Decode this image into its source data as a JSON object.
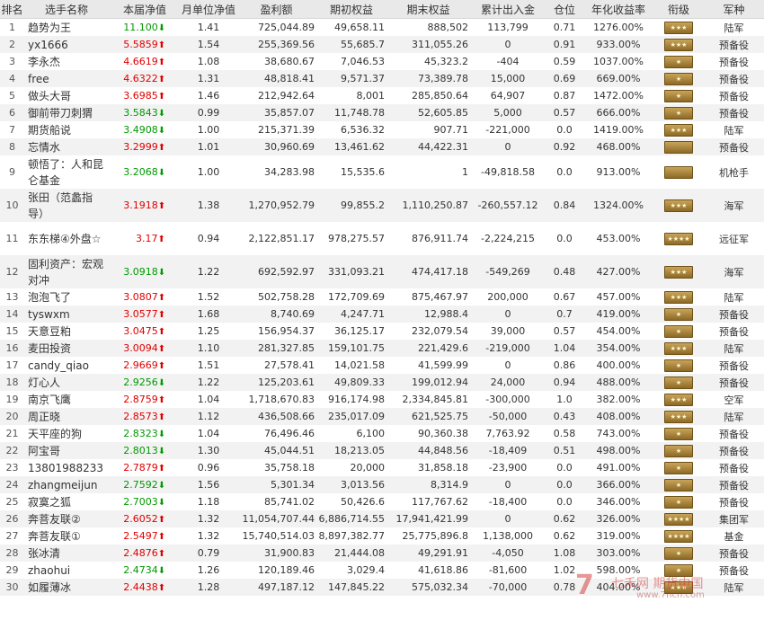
{
  "headers": [
    "排名",
    "选手名称",
    "本届净值",
    "月单位净值",
    "盈利额",
    "期初权益",
    "期末权益",
    "累计出入金",
    "仓位",
    "年化收益率",
    "衔级",
    "军种"
  ],
  "colors": {
    "up": "#e00000",
    "down": "#009900",
    "alt_row": "#f2f2f2",
    "header_bg": "#e9e9e9"
  },
  "rows": [
    {
      "rank": "1",
      "name": "趋势为王",
      "nav": "11.100",
      "dir": "down",
      "mnav": "1.41",
      "profit": "725,044.89",
      "start": "49,658.11",
      "end": "888,502",
      "flow": "113,799",
      "pos": "0.71",
      "annual": "1276.00%",
      "badge": "★★★",
      "branch": "陆军"
    },
    {
      "rank": "2",
      "name": "yx1666",
      "nav": "5.5859",
      "dir": "up",
      "mnav": "1.54",
      "profit": "255,369.56",
      "start": "55,685.7",
      "end": "311,055.26",
      "flow": "0",
      "pos": "0.91",
      "annual": "933.00%",
      "badge": "★★★",
      "branch": "预备役"
    },
    {
      "rank": "3",
      "name": "李永杰",
      "nav": "4.6619",
      "dir": "up",
      "mnav": "1.08",
      "profit": "38,680.67",
      "start": "7,046.53",
      "end": "45,323.2",
      "flow": "-404",
      "pos": "0.59",
      "annual": "1037.00%",
      "badge": "★",
      "branch": "预备役"
    },
    {
      "rank": "4",
      "name": "free",
      "nav": "4.6322",
      "dir": "up",
      "mnav": "1.31",
      "profit": "48,818.41",
      "start": "9,571.37",
      "end": "73,389.78",
      "flow": "15,000",
      "pos": "0.69",
      "annual": "669.00%",
      "badge": "★",
      "branch": "预备役"
    },
    {
      "rank": "5",
      "name": "做头大哥",
      "nav": "3.6985",
      "dir": "up",
      "mnav": "1.46",
      "profit": "212,942.64",
      "start": "8,001",
      "end": "285,850.64",
      "flow": "64,907",
      "pos": "0.87",
      "annual": "1472.00%",
      "badge": "★",
      "branch": "预备役"
    },
    {
      "rank": "6",
      "name": "御前带刀刺猬",
      "nav": "3.5843",
      "dir": "down",
      "mnav": "0.99",
      "profit": "35,857.07",
      "start": "11,748.78",
      "end": "52,605.85",
      "flow": "5,000",
      "pos": "0.57",
      "annual": "666.00%",
      "badge": "★",
      "branch": "预备役"
    },
    {
      "rank": "7",
      "name": "期货船说",
      "nav": "3.4908",
      "dir": "down",
      "mnav": "1.00",
      "profit": "215,371.39",
      "start": "6,536.32",
      "end": "907.71",
      "flow": "-221,000",
      "pos": "0.0",
      "annual": "1419.00%",
      "badge": "★★★",
      "branch": "陆军"
    },
    {
      "rank": "8",
      "name": "忘情水",
      "nav": "3.2999",
      "dir": "up",
      "mnav": "1.01",
      "profit": "30,960.69",
      "start": "13,461.62",
      "end": "44,422.31",
      "flow": "0",
      "pos": "0.92",
      "annual": "468.00%",
      "badge": "",
      "branch": "预备役"
    },
    {
      "rank": "9",
      "name": "顿悟了：人和昆仑基金",
      "nav": "3.2068",
      "dir": "down",
      "mnav": "1.00",
      "profit": "34,283.98",
      "start": "15,535.6",
      "end": "1",
      "flow": "-49,818.58",
      "pos": "0.0",
      "annual": "913.00%",
      "badge": "",
      "branch": "机枪手"
    },
    {
      "rank": "10",
      "name": "张田（范蠡指导）",
      "nav": "3.1918",
      "dir": "up",
      "mnav": "1.38",
      "profit": "1,270,952.79",
      "start": "99,855.2",
      "end": "1,110,250.87",
      "flow": "-260,557.12",
      "pos": "0.84",
      "annual": "1324.00%",
      "badge": "★★★",
      "branch": "海军"
    },
    {
      "rank": "11",
      "name": "东东梯④外盘☆",
      "nav": "3.17",
      "dir": "up",
      "mnav": "0.94",
      "profit": "2,122,851.17",
      "start": "978,275.57",
      "end": "876,911.74",
      "flow": "-2,224,215",
      "pos": "0.0",
      "annual": "453.00%",
      "badge": "★★★★",
      "branch": "远征军"
    },
    {
      "rank": "12",
      "name": "固利资产：宏观对冲",
      "nav": "3.0918",
      "dir": "down",
      "mnav": "1.22",
      "profit": "692,592.97",
      "start": "331,093.21",
      "end": "474,417.18",
      "flow": "-549,269",
      "pos": "0.48",
      "annual": "427.00%",
      "badge": "★★★",
      "branch": "海军"
    },
    {
      "rank": "13",
      "name": "泡泡飞了",
      "nav": "3.0807",
      "dir": "up",
      "mnav": "1.52",
      "profit": "502,758.28",
      "start": "172,709.69",
      "end": "875,467.97",
      "flow": "200,000",
      "pos": "0.67",
      "annual": "457.00%",
      "badge": "★★★",
      "branch": "陆军"
    },
    {
      "rank": "14",
      "name": "tyswxm",
      "nav": "3.0577",
      "dir": "up",
      "mnav": "1.68",
      "profit": "8,740.69",
      "start": "4,247.71",
      "end": "12,988.4",
      "flow": "0",
      "pos": "0.7",
      "annual": "419.00%",
      "badge": "★",
      "branch": "预备役"
    },
    {
      "rank": "15",
      "name": "天意豆粕",
      "nav": "3.0475",
      "dir": "up",
      "mnav": "1.25",
      "profit": "156,954.37",
      "start": "36,125.17",
      "end": "232,079.54",
      "flow": "39,000",
      "pos": "0.57",
      "annual": "454.00%",
      "badge": "★",
      "branch": "预备役"
    },
    {
      "rank": "16",
      "name": "麦田投资",
      "nav": "3.0094",
      "dir": "up",
      "mnav": "1.10",
      "profit": "281,327.85",
      "start": "159,101.75",
      "end": "221,429.6",
      "flow": "-219,000",
      "pos": "1.04",
      "annual": "354.00%",
      "badge": "★★★",
      "branch": "陆军"
    },
    {
      "rank": "17",
      "name": "candy_qiao",
      "nav": "2.9669",
      "dir": "up",
      "mnav": "1.51",
      "profit": "27,578.41",
      "start": "14,021.58",
      "end": "41,599.99",
      "flow": "0",
      "pos": "0.86",
      "annual": "400.00%",
      "badge": "★",
      "branch": "预备役"
    },
    {
      "rank": "18",
      "name": "灯心人",
      "nav": "2.9256",
      "dir": "down",
      "mnav": "1.22",
      "profit": "125,203.61",
      "start": "49,809.33",
      "end": "199,012.94",
      "flow": "24,000",
      "pos": "0.94",
      "annual": "488.00%",
      "badge": "★",
      "branch": "预备役"
    },
    {
      "rank": "19",
      "name": "南京飞鹰",
      "nav": "2.8759",
      "dir": "up",
      "mnav": "1.04",
      "profit": "1,718,670.83",
      "start": "916,174.98",
      "end": "2,334,845.81",
      "flow": "-300,000",
      "pos": "1.0",
      "annual": "382.00%",
      "badge": "★★★",
      "branch": "空军"
    },
    {
      "rank": "20",
      "name": "周正晓",
      "nav": "2.8573",
      "dir": "up",
      "mnav": "1.12",
      "profit": "436,508.66",
      "start": "235,017.09",
      "end": "621,525.75",
      "flow": "-50,000",
      "pos": "0.43",
      "annual": "408.00%",
      "badge": "★★★",
      "branch": "陆军"
    },
    {
      "rank": "21",
      "name": "天平座的狗",
      "nav": "2.8323",
      "dir": "down",
      "mnav": "1.04",
      "profit": "76,496.46",
      "start": "6,100",
      "end": "90,360.38",
      "flow": "7,763.92",
      "pos": "0.58",
      "annual": "743.00%",
      "badge": "★",
      "branch": "预备役"
    },
    {
      "rank": "22",
      "name": "阿宝哥",
      "nav": "2.8013",
      "dir": "down",
      "mnav": "1.30",
      "profit": "45,044.51",
      "start": "18,213.05",
      "end": "44,848.56",
      "flow": "-18,409",
      "pos": "0.51",
      "annual": "498.00%",
      "badge": "★",
      "branch": "预备役"
    },
    {
      "rank": "23",
      "name": "13801988233",
      "nav": "2.7879",
      "dir": "up",
      "mnav": "0.96",
      "profit": "35,758.18",
      "start": "20,000",
      "end": "31,858.18",
      "flow": "-23,900",
      "pos": "0.0",
      "annual": "491.00%",
      "badge": "★",
      "branch": "预备役"
    },
    {
      "rank": "24",
      "name": "zhangmeijun",
      "nav": "2.7592",
      "dir": "down",
      "mnav": "1.56",
      "profit": "5,301.34",
      "start": "3,013.56",
      "end": "8,314.9",
      "flow": "0",
      "pos": "0.0",
      "annual": "366.00%",
      "badge": "★",
      "branch": "预备役"
    },
    {
      "rank": "25",
      "name": "寂寞之狐",
      "nav": "2.7003",
      "dir": "down",
      "mnav": "1.18",
      "profit": "85,741.02",
      "start": "50,426.6",
      "end": "117,767.62",
      "flow": "-18,400",
      "pos": "0.0",
      "annual": "346.00%",
      "badge": "★",
      "branch": "预备役"
    },
    {
      "rank": "26",
      "name": "奔菩友联②",
      "nav": "2.6052",
      "dir": "up",
      "mnav": "1.32",
      "profit": "11,054,707.44",
      "start": "6,886,714.55",
      "end": "17,941,421.99",
      "flow": "0",
      "pos": "0.62",
      "annual": "326.00%",
      "badge": "★★★★",
      "branch": "集团军"
    },
    {
      "rank": "27",
      "name": "奔菩友联①",
      "nav": "2.5497",
      "dir": "up",
      "mnav": "1.32",
      "profit": "15,740,514.03",
      "start": "8,897,382.77",
      "end": "25,775,896.8",
      "flow": "1,138,000",
      "pos": "0.62",
      "annual": "319.00%",
      "badge": "★★★★",
      "branch": "基金"
    },
    {
      "rank": "28",
      "name": "张冰清",
      "nav": "2.4876",
      "dir": "up",
      "mnav": "0.79",
      "profit": "31,900.83",
      "start": "21,444.08",
      "end": "49,291.91",
      "flow": "-4,050",
      "pos": "1.08",
      "annual": "303.00%",
      "badge": "★",
      "branch": "预备役"
    },
    {
      "rank": "29",
      "name": "zhaohui",
      "nav": "2.4734",
      "dir": "down",
      "mnav": "1.26",
      "profit": "120,189.46",
      "start": "3,029.4",
      "end": "41,618.86",
      "flow": "-81,600",
      "pos": "1.02",
      "annual": "598.00%",
      "badge": "★",
      "branch": "预备役"
    },
    {
      "rank": "30",
      "name": "如履薄冰",
      "nav": "2.4438",
      "dir": "up",
      "mnav": "1.28",
      "profit": "497,187.12",
      "start": "147,845.22",
      "end": "575,032.34",
      "flow": "-70,000",
      "pos": "0.78",
      "annual": "404.00%",
      "badge": "★★★",
      "branch": "陆军"
    }
  ],
  "watermark": {
    "text": "七禾网 期货中国",
    "url": "www.7hcn.com"
  }
}
